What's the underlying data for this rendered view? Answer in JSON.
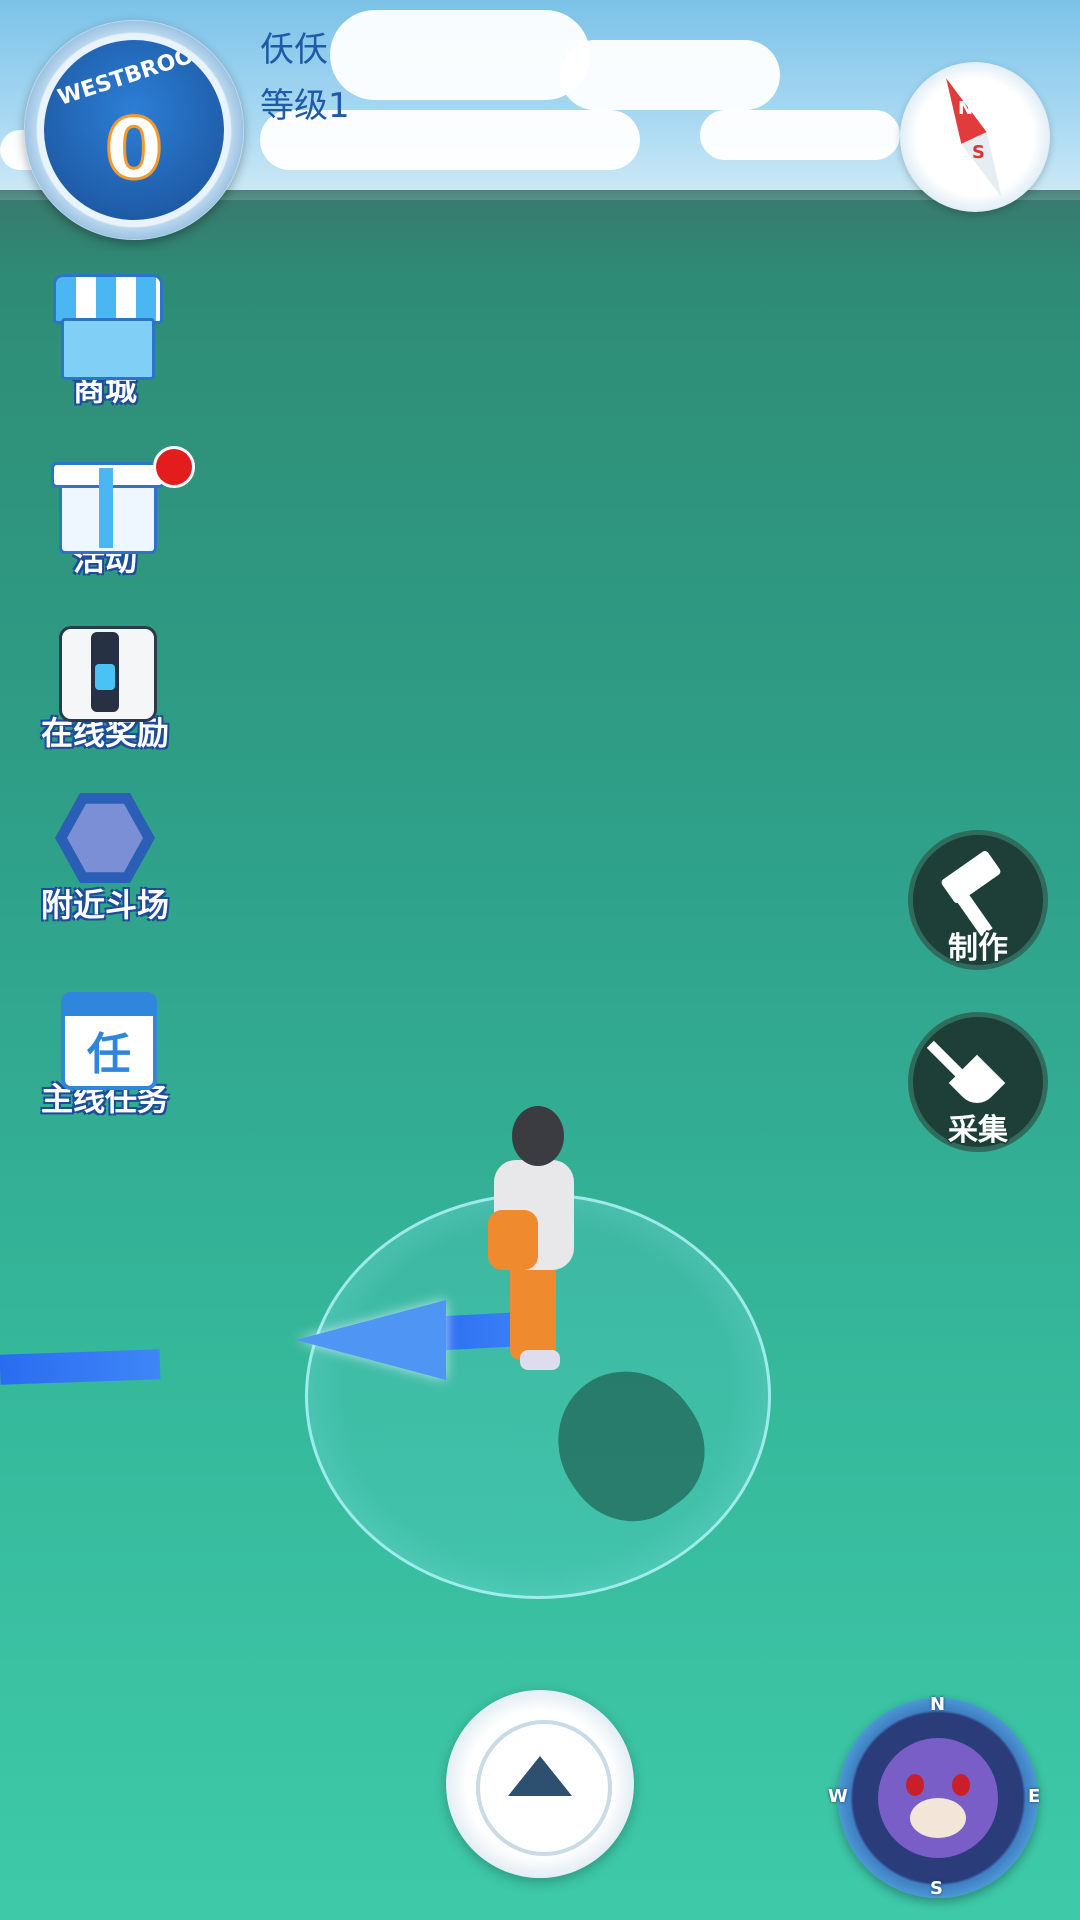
{
  "player": {
    "name": "仸仸",
    "level": "等级1"
  },
  "avatar": {
    "jersey_name": "WESTBROOK",
    "jersey_number": "0"
  },
  "compass": {
    "n": "N",
    "s": "S"
  },
  "menu": [
    {
      "label": "商城",
      "icon": "shop-icon"
    },
    {
      "label": "活动",
      "icon": "gift-icon"
    },
    {
      "label": "在线奖励",
      "icon": "chest-icon"
    },
    {
      "label": "附近斗场",
      "icon": "arena-icon"
    },
    {
      "label": "主线任务",
      "icon": "calendar-icon",
      "icon_text": "任"
    }
  ],
  "actions": {
    "craft": "制作",
    "gather": "采集"
  },
  "minimap": {
    "n": "N",
    "s": "S",
    "e": "E",
    "w": "W"
  },
  "colors": {
    "water": "#35b79a",
    "accent": "#1f5aa8",
    "notification": "#e31d1d"
  }
}
